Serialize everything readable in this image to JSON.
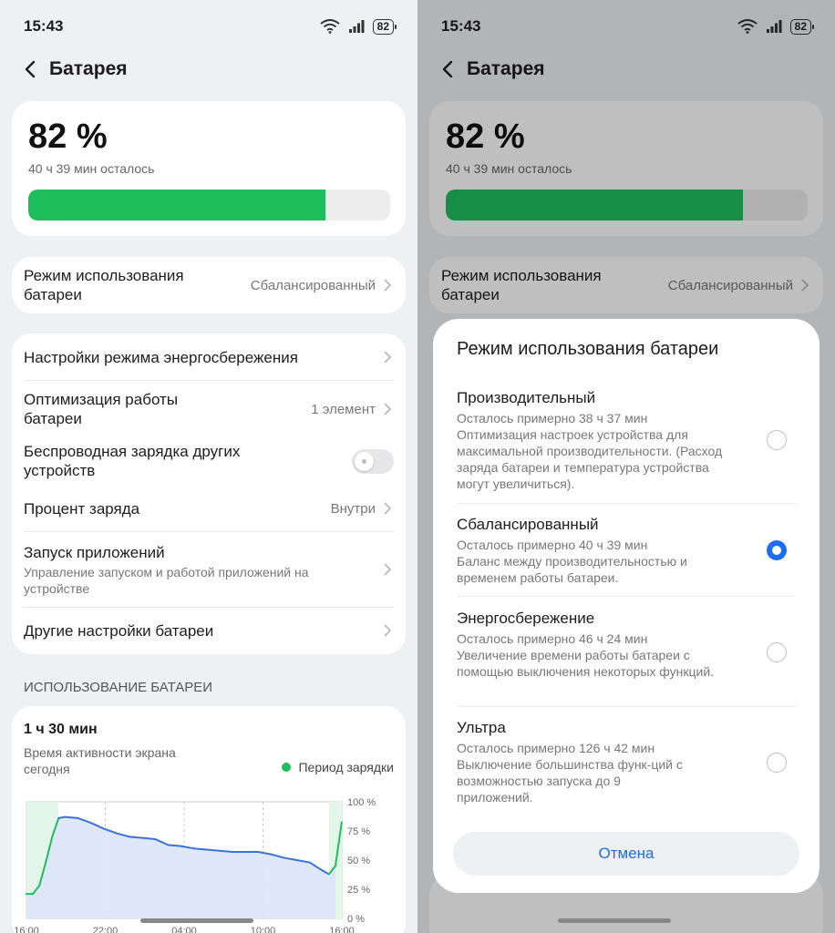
{
  "status_bar": {
    "time": "15:43",
    "battery": "82"
  },
  "header": {
    "title": "Батарея"
  },
  "battery": {
    "percent_text": "82 %",
    "remaining": "40 ч 39 мин осталось",
    "level": 0.82
  },
  "mode_row": {
    "label": "Режим использования батареи",
    "value": "Сбалансированный"
  },
  "settings": {
    "power_saving": {
      "label": "Настройки режима энергосбережения"
    },
    "optimization": {
      "label": "Оптимизация работы батареи",
      "value": "1 элемент"
    },
    "wireless": {
      "label": "Беспроводная зарядка других устройств",
      "enabled": false
    },
    "charge_percent": {
      "label": "Процент заряда",
      "value": "Внутри"
    },
    "app_launch": {
      "label": "Запуск приложений",
      "sub": "Управление запуском и работой приложений на устройстве"
    },
    "other": {
      "label": "Другие настройки батареи"
    }
  },
  "usage": {
    "section_title": "ИСПОЛЬЗОВАНИЕ БАТАРЕИ",
    "screen_time": "1 ч 30 мин",
    "screen_time_label": "Время активности экрана сегодня",
    "legend_charging": "Период зарядки"
  },
  "chart_data": {
    "type": "area",
    "x_ticks": [
      "16:00",
      "22:00",
      "04:00",
      "10:00",
      "16:00"
    ],
    "y_ticks": [
      "100 %",
      "75 %",
      "50 %",
      "25 %",
      "0 %"
    ],
    "ylim": [
      0,
      100
    ],
    "x": [
      0,
      0.5,
      1,
      1.5,
      2,
      2.5,
      3,
      4,
      5,
      6,
      7,
      8,
      9,
      10,
      11,
      12,
      13,
      14,
      15,
      16,
      17,
      18,
      19,
      20,
      21,
      22,
      23,
      23.5,
      24
    ],
    "y": [
      21,
      21,
      28,
      48,
      70,
      86,
      87,
      86,
      82,
      77,
      73,
      70,
      69,
      68,
      63,
      62,
      60,
      59,
      58,
      57,
      57,
      57,
      55,
      52,
      50,
      48,
      41,
      38,
      45
    ],
    "end_point": {
      "x": 24.5,
      "y": 83
    },
    "charging_periods": [
      [
        0,
        2.5
      ],
      [
        23.5,
        24.5
      ]
    ],
    "colors": {
      "line": "#3b73d9",
      "fill": "#dce6fa",
      "charge": "#1fbe5d",
      "charge_bg": "#e3f6e9"
    }
  },
  "sheet": {
    "title": "Режим использования батареи",
    "cancel": "Отмена",
    "options": [
      {
        "name": "Производительный",
        "remaining": "Осталось примерно 38 ч 37 мин",
        "desc": "Оптимизация настроек устройства для максимальной производительности. (Расход заряда батареи и температура устройства могут увеличиться).",
        "selected": false
      },
      {
        "name": "Сбалансированный",
        "remaining": "Осталось примерно 40 ч 39 мин",
        "desc": "Баланс между производительностью и временем работы батареи.",
        "selected": true
      },
      {
        "name": "Энергосбережение",
        "remaining": "Осталось примерно 46 ч 24 мин",
        "desc": "Увеличение времени работы батареи с помощью выключения некоторых функций.",
        "selected": false
      },
      {
        "name": "Ультра",
        "remaining": "Осталось примерно 126 ч 42 мин",
        "desc": "Выключение большинства функ-ций с возможностью запуска до 9 приложений.",
        "selected": false
      }
    ]
  }
}
